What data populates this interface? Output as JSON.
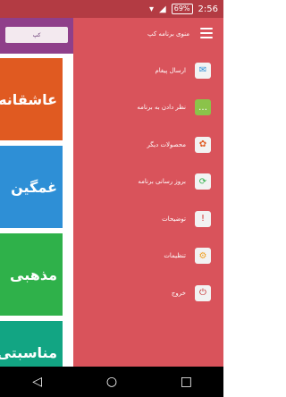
{
  "status_bar": {
    "time": "2:56",
    "battery": "69%"
  },
  "drawer": {
    "title": "منوی برنامه کپ",
    "items": [
      {
        "label": "ارسال پیغام",
        "icon": "mail-icon"
      },
      {
        "label": "نظر دادن به برنامه",
        "icon": "chat-icon"
      },
      {
        "label": "محصولات دیگر",
        "icon": "apps-icon"
      },
      {
        "label": "بروز رسانی برنامه",
        "icon": "refresh-icon"
      },
      {
        "label": "توضیحات",
        "icon": "warning-icon"
      },
      {
        "label": "تنظیمات",
        "icon": "gear-icon"
      },
      {
        "label": "خروج",
        "icon": "power-icon"
      }
    ]
  },
  "content": {
    "tiles": [
      {
        "label": "عاشقانه",
        "color": "#e05a21"
      },
      {
        "label": "غمگین",
        "color": "#2e8fd6"
      },
      {
        "label": "مذهبی",
        "color": "#2fb14a"
      },
      {
        "label": "مناسبتی",
        "color": "#12a583"
      }
    ]
  },
  "nav_bar": {
    "buttons": [
      "back",
      "home",
      "recents"
    ]
  }
}
